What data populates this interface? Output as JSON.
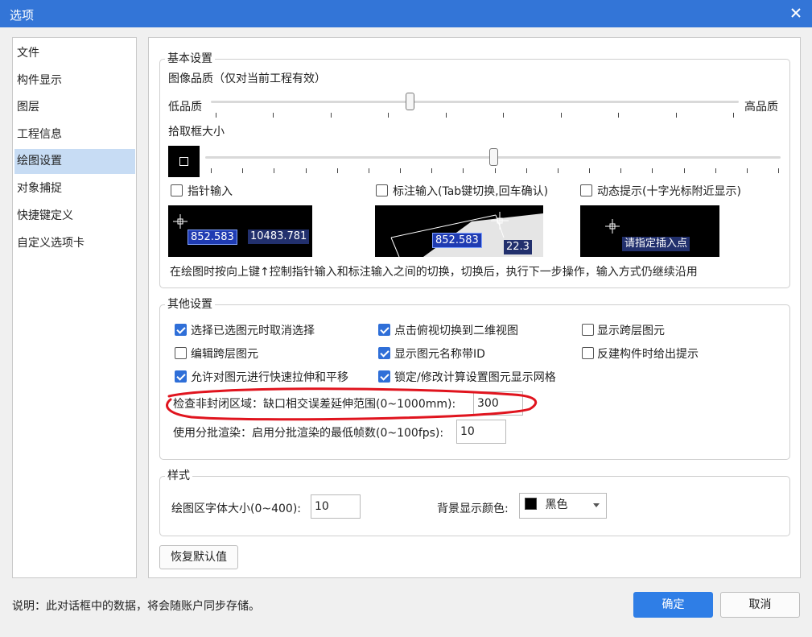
{
  "window": {
    "title": "选项"
  },
  "sidebar": {
    "items": [
      "文件",
      "构件显示",
      "图层",
      "工程信息",
      "绘图设置",
      "对象捕捉",
      "快捷键定义",
      "自定义选项卡"
    ],
    "active": "绘图设置"
  },
  "basic": {
    "title": "基本设置",
    "image_quality_label": "图像品质（仅对当前工程有效）",
    "low_label": "低品质",
    "high_label": "高品质",
    "image_quality_level": 0.39,
    "pick_box_label": "拾取框大小",
    "pick_box_level": 0.5,
    "pointer_input_label": "指针输入",
    "dim_input_label": "标注输入(Tab键切换,回车确认)",
    "dynamic_tip_label": "动态提示(十字光标附近显示)",
    "preview1_val1": "852.583",
    "preview1_val2": "10483.781",
    "preview2_val1": "852.583",
    "preview2_val2": "22.3",
    "preview3_text": "请指定插入点",
    "description": "在绘图时按向上键↑控制指针输入和标注输入之间的切换，切换后，执行下一步操作，输入方式仍继续沿用"
  },
  "other": {
    "title": "其他设置",
    "options": [
      {
        "label": "选择已选图元时取消选择",
        "checked": true
      },
      {
        "label": "点击俯视切换到二维视图",
        "checked": true
      },
      {
        "label": "显示跨层图元",
        "checked": false
      },
      {
        "label": "编辑跨层图元",
        "checked": false
      },
      {
        "label": "显示图元名称带ID",
        "checked": true
      },
      {
        "label": "反建构件时给出提示",
        "checked": false
      },
      {
        "label": "允许对图元进行快速拉伸和平移",
        "checked": true
      },
      {
        "label": "锁定/修改计算设置图元显示网格",
        "checked": true
      }
    ],
    "gap_label": "检查非封闭区域：缺口相交误差延伸范围(0~1000mm):",
    "gap_value": "300",
    "batch_label": "使用分批渲染：启用分批渲染的最低帧数(0~100fps):",
    "batch_value": "10"
  },
  "style": {
    "title": "样式",
    "font_size_label": "绘图区字体大小(0~400):",
    "font_size_value": "10",
    "bg_color_label": "背景显示颜色:",
    "bg_color_value": "黑色",
    "bg_color_swatch": "#000000"
  },
  "reset_label": "恢复默认值",
  "footer": {
    "note": "说明：此对话框中的数据，将会随账户同步存储。",
    "ok_label": "确定",
    "cancel_label": "取消"
  },
  "colors": {
    "titlebar": "#3375d7",
    "primary": "#2f7ee6",
    "annotation": "#e0141e",
    "active_item": "#c7dcf4"
  }
}
